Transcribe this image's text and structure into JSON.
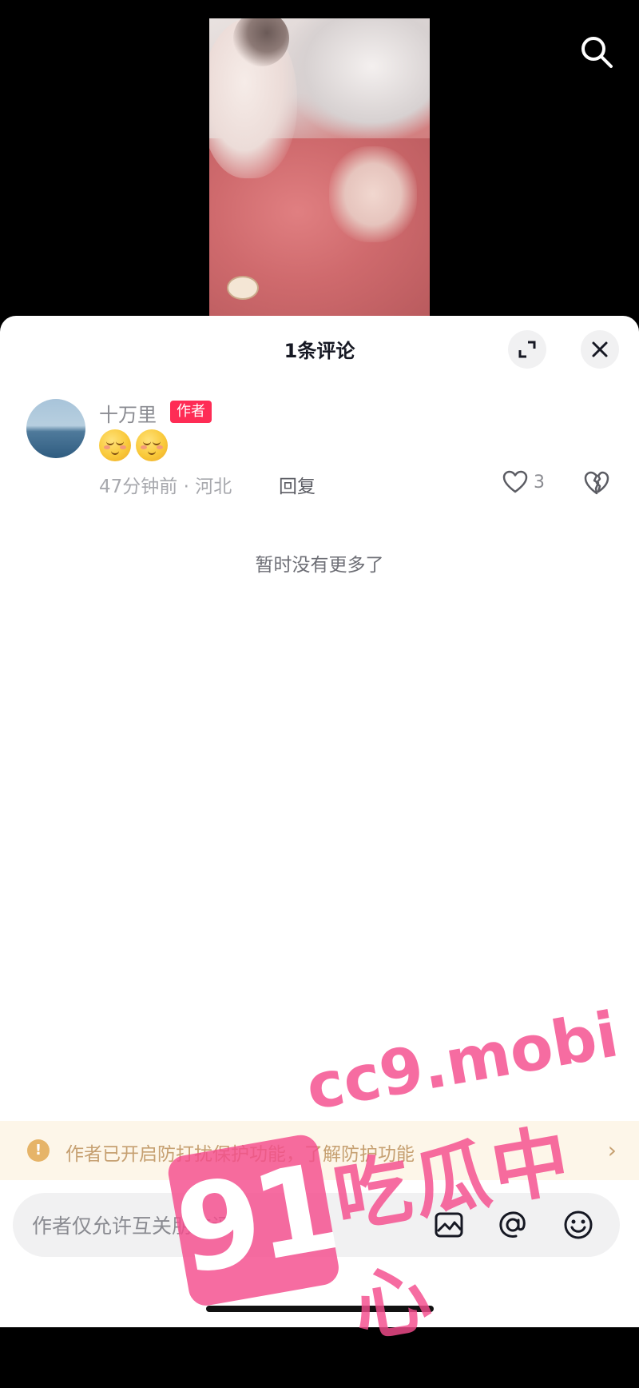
{
  "header": {
    "title": "1条评论"
  },
  "comment": {
    "username": "十万里",
    "author_badge": "作者",
    "time_location": "47分钟前 · 河北",
    "reply_label": "回复",
    "like_count": "3",
    "emoji": [
      "relieved-face",
      "relieved-face"
    ]
  },
  "list": {
    "end_text": "暂时没有更多了"
  },
  "notice": {
    "text": "作者已开启防打扰保护功能，",
    "link": "了解防护功能",
    "icon": "exclamation-icon"
  },
  "input": {
    "placeholder": "作者仅允许互关朋友评论"
  },
  "watermark": {
    "number": "91",
    "url": "cc9.mobi",
    "name": "吃瓜中心"
  },
  "colors": {
    "accent": "#fe2c55",
    "notice_text": "#c6a071",
    "notice_bg": "#fdf6e9",
    "watermark": "#f44c8c"
  }
}
